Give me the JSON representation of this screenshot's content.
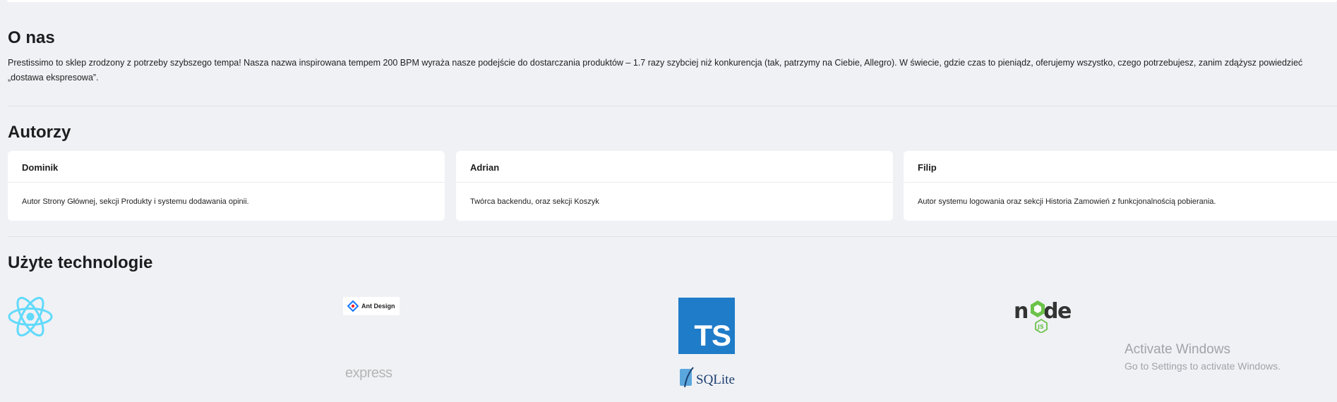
{
  "about": {
    "heading": "O nas",
    "text": "Prestissimo to sklep zrodzony z potrzeby szybszego tempa! Nasza nazwa inspirowana tempem 200 BPM wyraża nasze podejście do dostarczania produktów – 1.7 razy szybciej niż konkurencja (tak, patrzymy na Ciebie, Allegro). W świecie, gdzie czas to pieniądz, oferujemy wszystko, czego potrzebujesz, zanim zdążysz powiedzieć „dostawa ekspresowa”."
  },
  "authors": {
    "heading": "Autorzy",
    "items": [
      {
        "name": "Dominik",
        "description": "Autor Strony Głównej, sekcji Produkty i systemu dodawania opinii."
      },
      {
        "name": "Adrian",
        "description": "Twórca backendu, oraz sekcji Koszyk"
      },
      {
        "name": "Filip",
        "description": "Autor systemu logowania oraz sekcji Historia Zamowień z funkcjonalnością pobierania."
      }
    ]
  },
  "technologies": {
    "heading": "Użyte technologie",
    "items": [
      {
        "icon": "react-logo-icon"
      },
      {
        "icon": "ant-design-logo-icon",
        "label": "Ant Design"
      },
      {
        "icon": "typescript-logo-icon",
        "label": "TS"
      },
      {
        "icon": "nodejs-logo-icon"
      },
      {
        "icon": "express-logo-icon",
        "label": "express"
      },
      {
        "icon": "sqlite-logo-icon",
        "label": "SQLite"
      }
    ]
  },
  "watermark": {
    "title": "Activate Windows",
    "subtitle": "Go to Settings to activate Windows."
  },
  "colors": {
    "background": "#f0f1f5",
    "card": "#ffffff",
    "react": "#61dafb",
    "typescript": "#1f7cc9",
    "node_green": "#6cc24a"
  }
}
